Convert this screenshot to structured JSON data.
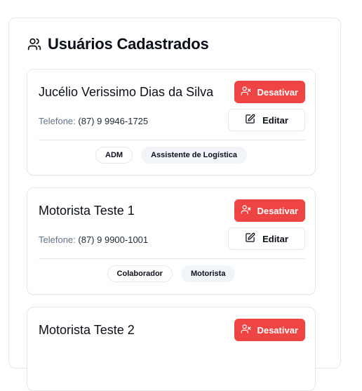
{
  "panel": {
    "title": "Usuários Cadastrados",
    "icon": "users-icon"
  },
  "users": [
    {
      "name": "Jucélio Verissimo Dias da Silva",
      "phone_label": "Telefone:",
      "phone": "(87) 9 9946-1725",
      "deactivate_label": "Desativar",
      "edit_label": "Editar",
      "badges": [
        "ADM",
        "Assistente de Logística"
      ]
    },
    {
      "name": "Motorista Teste 1",
      "phone_label": "Telefone:",
      "phone": "(87) 9 9900-1001",
      "deactivate_label": "Desativar",
      "edit_label": "Editar",
      "badges": [
        "Colaborador",
        "Motorista"
      ]
    },
    {
      "name": "Motorista Teste 2",
      "deactivate_label": "Desativar"
    }
  ],
  "colors": {
    "danger": "#ef4444",
    "border": "#e5e7eb",
    "muted_text": "#64748b",
    "badge_fill": "#f1f5f9"
  }
}
